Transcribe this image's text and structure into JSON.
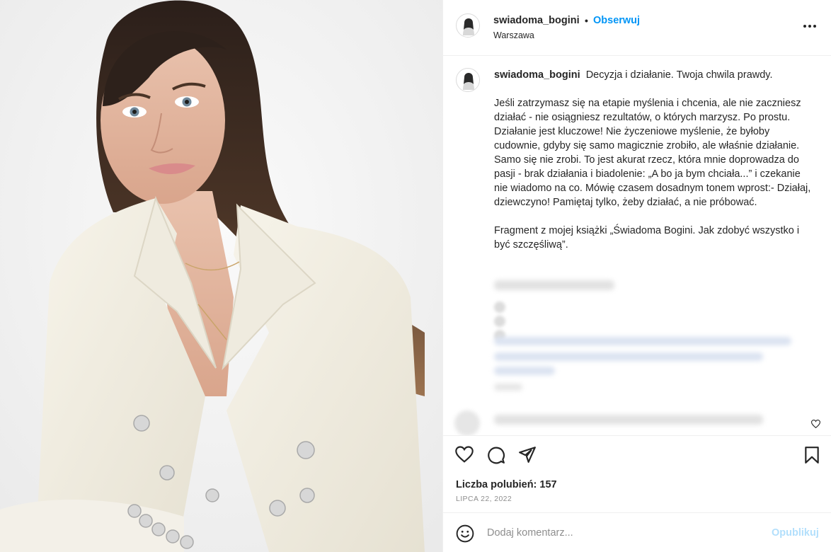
{
  "post": {
    "username": "swiadoma_bogini",
    "separator": "•",
    "follow_label": "Obserwuj",
    "location": "Warszawa",
    "more_icon": "more-horizontal-icon"
  },
  "caption": {
    "username": "swiadoma_bogini",
    "headline": "Decyzja i działanie. Twoja chwila prawdy.",
    "paragraph1": "Jeśli zatrzymasz się na etapie myślenia i chcenia, ale nie zaczniesz działać - nie osiągniesz rezultatów, o których marzysz. Po prostu. Działanie jest kluczowe! Nie życzeniowe myślenie, że byłoby cudownie, gdyby się samo magicznie zrobiło, ale właśnie działanie. Samo się nie zrobi. To jest akurat rzecz, która mnie doprowadza do pasji - brak działania i biadolenie: „A bo ja bym chciała...” i czekanie nie wiadomo na co. Mówię czasem dosadnym tonem wprost:- Działaj, dziewczyno! Pamiętaj tylko, żeby działać, a nie próbować.",
    "paragraph2": "Fragment z mojej książki „Świadoma Bogini. Jak zdobyć wszystko i być szczęśliwą”."
  },
  "actions": {
    "icons": [
      "heart-icon",
      "comment-icon",
      "share-icon",
      "bookmark-icon"
    ],
    "likes_text": "Liczba polubień: 157",
    "date": "LIPCA 22, 2022"
  },
  "comment_box": {
    "placeholder": "Dodaj komentarz...",
    "publish_label": "Opublikuj"
  },
  "colors": {
    "accent": "#0095f6",
    "publish_disabled": "#b2dffc",
    "text": "#262626",
    "muted": "#8e8e8e",
    "border": "#efefef"
  }
}
